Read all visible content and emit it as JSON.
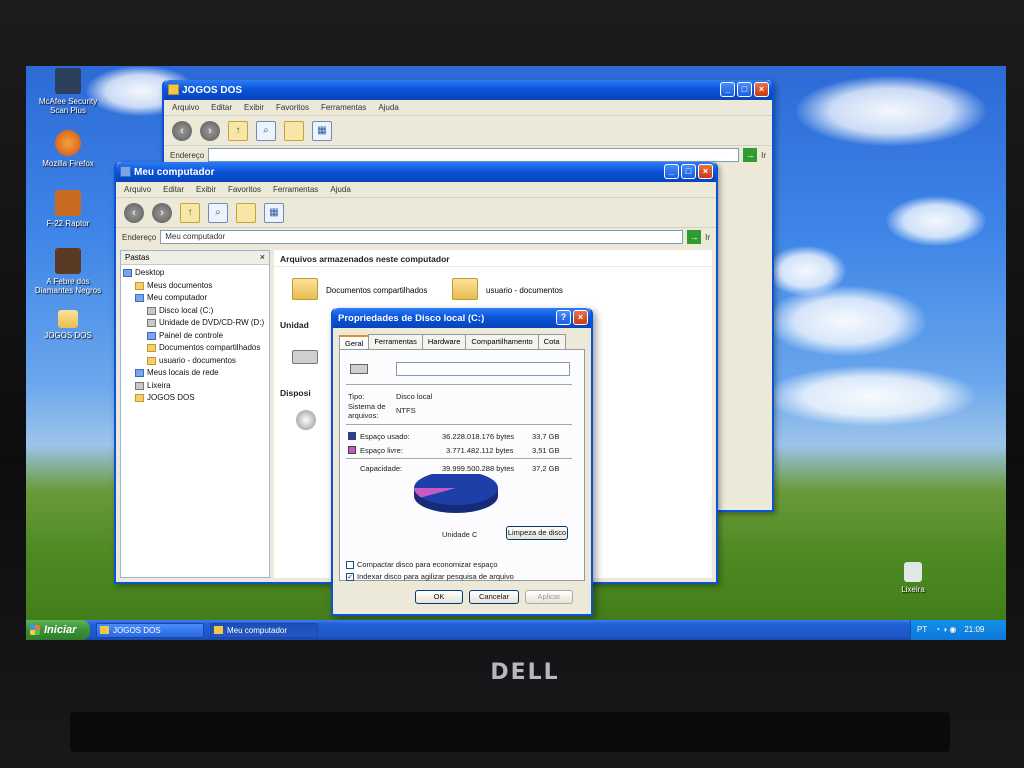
{
  "desktop": {
    "icons": [
      {
        "label": "McAfee Security Scan Plus",
        "color": "#2c3f5c"
      },
      {
        "label": "Mozilla Firefox",
        "color": "#e76f1e"
      },
      {
        "label": "F-22 Raptor",
        "color": "#c86b20"
      },
      {
        "label": "A Febre dos Diamantes Negros",
        "color": "#5a3a24"
      },
      {
        "label": "JOGOS DOS",
        "color": "#f2c84a"
      }
    ],
    "recycle_bin": "Lixeira"
  },
  "window_jogos": {
    "title": "JOGOS DOS",
    "menu": [
      "Arquivo",
      "Editar",
      "Exibir",
      "Favoritos",
      "Ferramentas",
      "Ajuda"
    ],
    "address_label": "Endereço",
    "go_label": "Ir"
  },
  "window_meu": {
    "title": "Meu computador",
    "menu": [
      "Arquivo",
      "Editar",
      "Exibir",
      "Favoritos",
      "Ferramentas",
      "Ajuda"
    ],
    "address_label": "Endereço",
    "address_value": "Meu computador",
    "go_label": "Ir",
    "folders_pane": {
      "title": "Pastas",
      "close": "×",
      "tree": [
        {
          "label": "Desktop",
          "icon": "desktop-icon",
          "level": 0
        },
        {
          "label": "Meus documentos",
          "icon": "folder-icon",
          "level": 1
        },
        {
          "label": "Meu computador",
          "icon": "computer-icon",
          "level": 1
        },
        {
          "label": "Disco local (C:)",
          "icon": "disk-icon",
          "level": 2
        },
        {
          "label": "Unidade de DVD/CD-RW (D:)",
          "icon": "cd-drive-icon",
          "level": 2
        },
        {
          "label": "Painel de controle",
          "icon": "control-panel-icon",
          "level": 2
        },
        {
          "label": "Documentos compartilhados",
          "icon": "folder-icon",
          "level": 2
        },
        {
          "label": "usuario - documentos",
          "icon": "folder-icon",
          "level": 2
        },
        {
          "label": "Meus locais de rede",
          "icon": "network-icon",
          "level": 1
        },
        {
          "label": "Lixeira",
          "icon": "recycle-bin-icon",
          "level": 1
        },
        {
          "label": "JOGOS DOS",
          "icon": "folder-icon",
          "level": 1
        }
      ]
    },
    "main": {
      "section_stored": "Arquivos armazenados neste computador",
      "stored_items": [
        "Documentos compartilhados",
        "usuario - documentos"
      ],
      "section_drives": "Unidad",
      "section_removable": "Disposi"
    }
  },
  "dialog": {
    "title": "Propriedades de Disco local (C:)",
    "help": "?",
    "close": "×",
    "tabs": [
      "Geral",
      "Ferramentas",
      "Hardware",
      "Compartilhamento",
      "Cota"
    ],
    "active_tab": "Geral",
    "name_value": "",
    "type_label": "Tipo:",
    "type_value": "Disco local",
    "fs_label": "Sistema de arquivos:",
    "fs_value": "NTFS",
    "used_label": "Espaço usado:",
    "used_bytes": "36.228.018.176 bytes",
    "used_gb": "33,7 GB",
    "free_label": "Espaço livre:",
    "free_bytes": "3.771.482.112 bytes",
    "free_gb": "3,51 GB",
    "capacity_label": "Capacidade:",
    "capacity_bytes": "39.999.500.288 bytes",
    "capacity_gb": "37,2 GB",
    "used_fraction": 0.906,
    "used_color": "#1f3fa8",
    "free_color": "#c85ac8",
    "drive_label": "Unidade C",
    "cleanup_button": "Limpeza de disco",
    "compress_label": "Compactar disco para economizar espaço",
    "compress_checked": false,
    "index_label": "Indexar disco para agilizar pesquisa de arquivo",
    "index_checked": true,
    "ok": "OK",
    "cancel": "Cancelar",
    "apply": "Aplicar"
  },
  "taskbar": {
    "start": "Iniciar",
    "tasks": [
      "JOGOS DOS",
      "Meu computador"
    ],
    "lang": "PT",
    "clock": "21:09"
  },
  "bezel": {
    "brand": "DELL"
  }
}
